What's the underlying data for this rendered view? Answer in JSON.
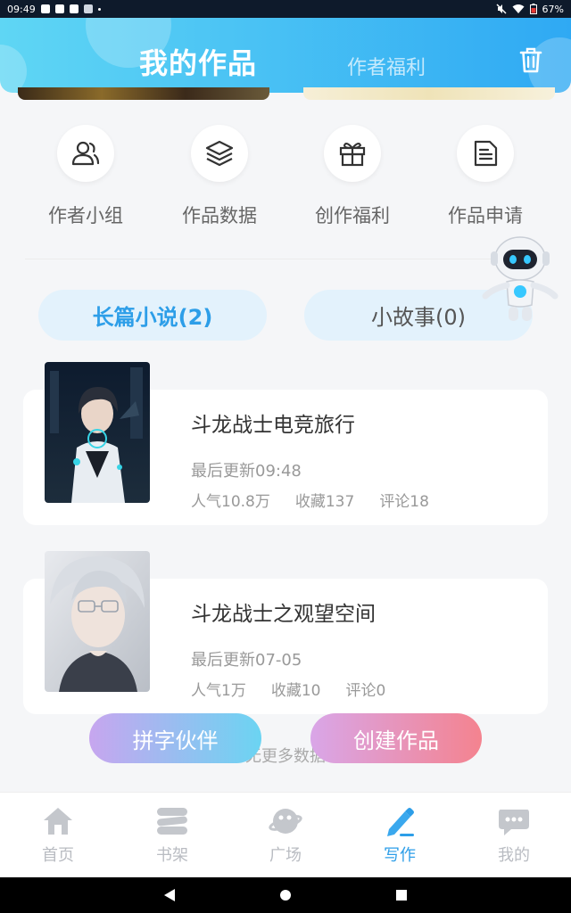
{
  "status_bar": {
    "time": "09:49",
    "battery": "67%"
  },
  "header": {
    "tab_my_works": "我的作品",
    "tab_author_welfare": "作者福利"
  },
  "quick_menu": [
    {
      "label": "作者小组",
      "icon": "author-group-icon"
    },
    {
      "label": "作品数据",
      "icon": "layers-icon"
    },
    {
      "label": "创作福利",
      "icon": "gift-icon"
    },
    {
      "label": "作品申请",
      "icon": "document-icon"
    }
  ],
  "type_tabs": {
    "long_novel": "长篇小说(2)",
    "short_story": "小故事(0)"
  },
  "works": [
    {
      "title": "斗龙战士电竞旅行",
      "update": "最后更新09:48",
      "popularity": "人气10.8万",
      "favorites": "收藏137",
      "comments": "评论18"
    },
    {
      "title": "斗龙战士之观望空间",
      "update": "最后更新07-05",
      "popularity": "人气1万",
      "favorites": "收藏10",
      "comments": "评论0"
    }
  ],
  "no_more": "无更多数据",
  "floating_buttons": {
    "partner": "拼字伙伴",
    "create": "创建作品"
  },
  "bottom_nav": [
    {
      "label": "首页",
      "icon": "home-icon"
    },
    {
      "label": "书架",
      "icon": "bookshelf-icon"
    },
    {
      "label": "广场",
      "icon": "planet-icon"
    },
    {
      "label": "写作",
      "icon": "pen-icon",
      "active": true
    },
    {
      "label": "我的",
      "icon": "chat-bubble-icon"
    }
  ],
  "colors": {
    "accent": "#2d9ee8",
    "header_start": "#5fd6f4",
    "header_end": "#2fa9f3"
  }
}
